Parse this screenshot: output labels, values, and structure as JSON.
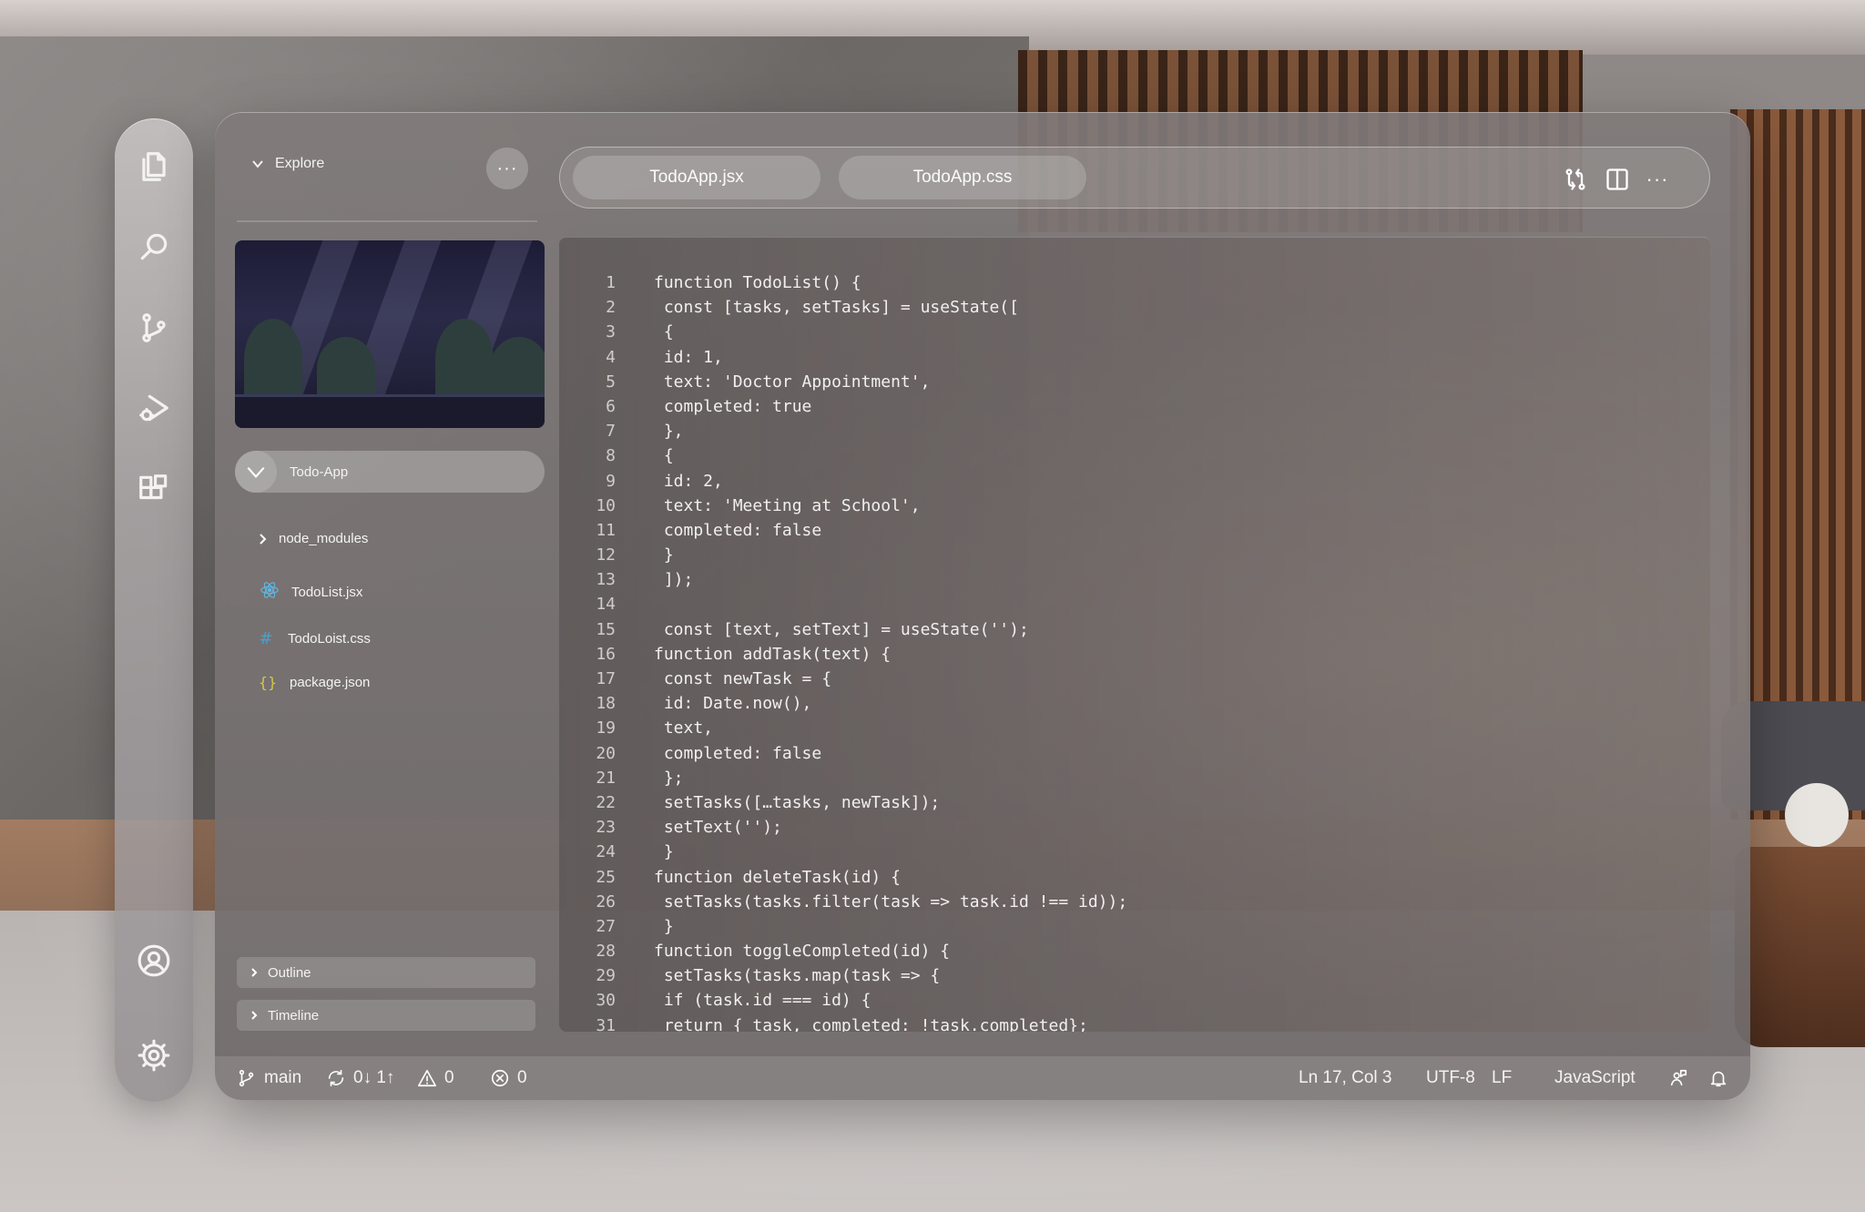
{
  "sidebar_rail": {
    "icons": [
      "files-icon",
      "search-icon",
      "source-control-icon",
      "run-debug-icon",
      "extensions-icon",
      "account-icon",
      "settings-icon"
    ]
  },
  "explorer": {
    "title": "Explore",
    "more_label": "···",
    "project": "Todo-App",
    "files": [
      {
        "name": "node_modules",
        "icon": "chevron-right-icon",
        "type": "folder"
      },
      {
        "name": "TodoList.jsx",
        "icon": "react-icon",
        "type": "file"
      },
      {
        "name": "TodoLoist.css",
        "icon": "hash-icon",
        "type": "file"
      },
      {
        "name": "package.json",
        "icon": "braces-icon",
        "type": "file"
      }
    ],
    "outline_label": "Outline",
    "timeline_label": "Timeline"
  },
  "tabs": [
    {
      "label": "TodoApp.jsx"
    },
    {
      "label": "TodoApp.css"
    }
  ],
  "tab_actions": [
    "compare-changes-icon",
    "split-editor-icon",
    "more-icon"
  ],
  "tab_more_label": "···",
  "code": [
    "function TodoList() {",
    " const [tasks, setTasks] = useState([",
    " {",
    " id: 1,",
    " text: 'Doctor Appointment',",
    " completed: true",
    " },",
    " {",
    " id: 2,",
    " text: 'Meeting at School',",
    " completed: false",
    " }",
    " ]);",
    "",
    " const [text, setText] = useState('');",
    "function addTask(text) {",
    " const newTask = {",
    " id: Date.now(),",
    " text,",
    " completed: false",
    " };",
    " setTasks([…tasks, newTask]);",
    " setText('');",
    " }",
    "function deleteTask(id) {",
    " setTasks(tasks.filter(task => task.id !== id));",
    " }",
    "function toggleCompleted(id) {",
    " setTasks(tasks.map(task => {",
    " if (task.id === id) {",
    " return { task, completed: !task.completed};"
  ],
  "statusbar": {
    "branch": "main",
    "sync": "0↓ 1↑",
    "warnings": "0",
    "errors": "0",
    "position": "Ln 17, Col 3",
    "encoding": "UTF-8",
    "eol": "LF",
    "language": "JavaScript"
  },
  "colors": {
    "text": "#f4f2f2",
    "react_icon": "#5fb6e0",
    "css_icon": "#4a9fd0",
    "json_icon": "#d7c84a"
  }
}
